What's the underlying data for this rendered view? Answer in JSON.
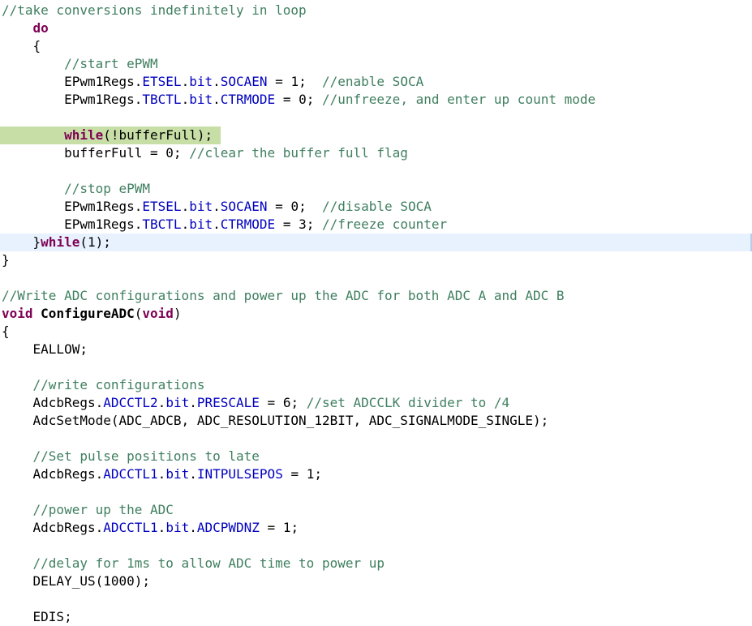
{
  "editor": {
    "colors": {
      "background": "#ffffff",
      "comment": "#3f7f5f",
      "keyword": "#7f0055",
      "field": "#0000c0",
      "current_line": "#e8f2fe",
      "breakpoint_highlight": "#c7dfa6"
    },
    "highlighted_line": 7,
    "current_line": 13,
    "lines": [
      [
        {
          "t": "comment",
          "v": "//take conversions indefinitely in loop"
        }
      ],
      [
        {
          "t": "plain",
          "v": "    "
        },
        {
          "t": "keyword",
          "v": "do"
        }
      ],
      [
        {
          "t": "plain",
          "v": "    {"
        }
      ],
      [
        {
          "t": "plain",
          "v": "        "
        },
        {
          "t": "comment",
          "v": "//start ePWM"
        }
      ],
      [
        {
          "t": "plain",
          "v": "        EPwm1Regs."
        },
        {
          "t": "field",
          "v": "ETSEL"
        },
        {
          "t": "plain",
          "v": "."
        },
        {
          "t": "field",
          "v": "bit"
        },
        {
          "t": "plain",
          "v": "."
        },
        {
          "t": "field",
          "v": "SOCAEN"
        },
        {
          "t": "plain",
          "v": " = 1;  "
        },
        {
          "t": "comment",
          "v": "//enable SOCA"
        }
      ],
      [
        {
          "t": "plain",
          "v": "        EPwm1Regs."
        },
        {
          "t": "field",
          "v": "TBCTL"
        },
        {
          "t": "plain",
          "v": "."
        },
        {
          "t": "field",
          "v": "bit"
        },
        {
          "t": "plain",
          "v": "."
        },
        {
          "t": "field",
          "v": "CTRMODE"
        },
        {
          "t": "plain",
          "v": " = 0; "
        },
        {
          "t": "comment",
          "v": "//unfreeze, and enter up count mode"
        }
      ],
      [
        {
          "t": "plain",
          "v": ""
        }
      ],
      [
        {
          "t": "plain",
          "v": "        "
        },
        {
          "t": "keyword",
          "v": "while"
        },
        {
          "t": "plain",
          "v": "(!bufferFull);"
        }
      ],
      [
        {
          "t": "plain",
          "v": "        bufferFull = 0; "
        },
        {
          "t": "comment",
          "v": "//clear the buffer full flag"
        }
      ],
      [
        {
          "t": "plain",
          "v": ""
        }
      ],
      [
        {
          "t": "plain",
          "v": "        "
        },
        {
          "t": "comment",
          "v": "//stop ePWM"
        }
      ],
      [
        {
          "t": "plain",
          "v": "        EPwm1Regs."
        },
        {
          "t": "field",
          "v": "ETSEL"
        },
        {
          "t": "plain",
          "v": "."
        },
        {
          "t": "field",
          "v": "bit"
        },
        {
          "t": "plain",
          "v": "."
        },
        {
          "t": "field",
          "v": "SOCAEN"
        },
        {
          "t": "plain",
          "v": " = 0;  "
        },
        {
          "t": "comment",
          "v": "//disable SOCA"
        }
      ],
      [
        {
          "t": "plain",
          "v": "        EPwm1Regs."
        },
        {
          "t": "field",
          "v": "TBCTL"
        },
        {
          "t": "plain",
          "v": "."
        },
        {
          "t": "field",
          "v": "bit"
        },
        {
          "t": "plain",
          "v": "."
        },
        {
          "t": "field",
          "v": "CTRMODE"
        },
        {
          "t": "plain",
          "v": " = 3; "
        },
        {
          "t": "comment",
          "v": "//freeze counter"
        }
      ],
      [
        {
          "t": "plain",
          "v": "    }"
        },
        {
          "t": "keyword",
          "v": "while"
        },
        {
          "t": "plain",
          "v": "(1);"
        }
      ],
      [
        {
          "t": "plain",
          "v": "}"
        }
      ],
      [
        {
          "t": "plain",
          "v": ""
        }
      ],
      [
        {
          "t": "comment",
          "v": "//Write ADC configurations and power up the ADC for both ADC A and ADC B"
        }
      ],
      [
        {
          "t": "keyword",
          "v": "void"
        },
        {
          "t": "plain",
          "v": " "
        },
        {
          "t": "func",
          "v": "ConfigureADC"
        },
        {
          "t": "plain",
          "v": "("
        },
        {
          "t": "keyword",
          "v": "void"
        },
        {
          "t": "plain",
          "v": ")"
        }
      ],
      [
        {
          "t": "plain",
          "v": "{"
        }
      ],
      [
        {
          "t": "plain",
          "v": "    EALLOW;"
        }
      ],
      [
        {
          "t": "plain",
          "v": ""
        }
      ],
      [
        {
          "t": "plain",
          "v": "    "
        },
        {
          "t": "comment",
          "v": "//write configurations"
        }
      ],
      [
        {
          "t": "plain",
          "v": "    AdcbRegs."
        },
        {
          "t": "field",
          "v": "ADCCTL2"
        },
        {
          "t": "plain",
          "v": "."
        },
        {
          "t": "field",
          "v": "bit"
        },
        {
          "t": "plain",
          "v": "."
        },
        {
          "t": "field",
          "v": "PRESCALE"
        },
        {
          "t": "plain",
          "v": " = 6; "
        },
        {
          "t": "comment",
          "v": "//set ADCCLK divider to /4"
        }
      ],
      [
        {
          "t": "plain",
          "v": "    AdcSetMode(ADC_ADCB, ADC_RESOLUTION_12BIT, ADC_SIGNALMODE_SINGLE);"
        }
      ],
      [
        {
          "t": "plain",
          "v": ""
        }
      ],
      [
        {
          "t": "plain",
          "v": "    "
        },
        {
          "t": "comment",
          "v": "//Set pulse positions to late"
        }
      ],
      [
        {
          "t": "plain",
          "v": "    AdcbRegs."
        },
        {
          "t": "field",
          "v": "ADCCTL1"
        },
        {
          "t": "plain",
          "v": "."
        },
        {
          "t": "field",
          "v": "bit"
        },
        {
          "t": "plain",
          "v": "."
        },
        {
          "t": "field",
          "v": "INTPULSEPOS"
        },
        {
          "t": "plain",
          "v": " = 1;"
        }
      ],
      [
        {
          "t": "plain",
          "v": ""
        }
      ],
      [
        {
          "t": "plain",
          "v": "    "
        },
        {
          "t": "comment",
          "v": "//power up the ADC"
        }
      ],
      [
        {
          "t": "plain",
          "v": "    AdcbRegs."
        },
        {
          "t": "field",
          "v": "ADCCTL1"
        },
        {
          "t": "plain",
          "v": "."
        },
        {
          "t": "field",
          "v": "bit"
        },
        {
          "t": "plain",
          "v": "."
        },
        {
          "t": "field",
          "v": "ADCPWDNZ"
        },
        {
          "t": "plain",
          "v": " = 1;"
        }
      ],
      [
        {
          "t": "plain",
          "v": ""
        }
      ],
      [
        {
          "t": "plain",
          "v": "    "
        },
        {
          "t": "comment",
          "v": "//delay for 1ms to allow ADC time to power up"
        }
      ],
      [
        {
          "t": "plain",
          "v": "    DELAY_US(1000);"
        }
      ],
      [
        {
          "t": "plain",
          "v": ""
        }
      ],
      [
        {
          "t": "plain",
          "v": "    EDIS;"
        }
      ]
    ]
  }
}
